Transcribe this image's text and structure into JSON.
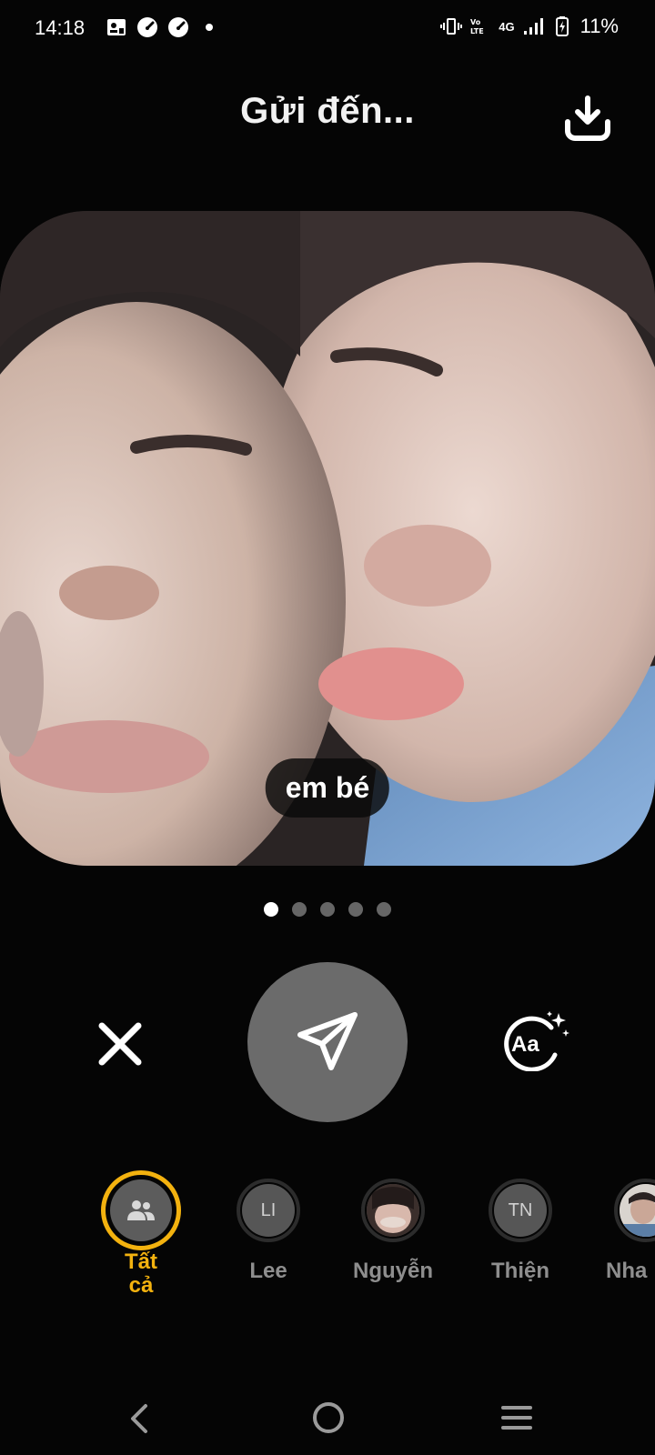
{
  "status_bar": {
    "time": "14:18",
    "network": "4G",
    "battery": "11%",
    "left_icons": [
      "contact-card-icon",
      "speedometer-icon",
      "speedometer-icon",
      "dot-icon"
    ],
    "right_icons": [
      "vibrate-icon",
      "volte-icon",
      "signal-icon",
      "battery-charging-icon"
    ]
  },
  "header": {
    "title": "Gửi đến...",
    "download_icon": "download-icon"
  },
  "photo": {
    "caption": "em bé"
  },
  "pager": {
    "count": 5,
    "active_index": 0
  },
  "actions": {
    "close_icon": "close-icon",
    "send_icon": "send-icon",
    "text_icon": "text-style-icon",
    "text_icon_label": "Aa"
  },
  "recipients": [
    {
      "name": "Tất cả",
      "initials": "",
      "selected": true,
      "avatar": "group-icon"
    },
    {
      "name": "Lee",
      "initials": "LI",
      "selected": false
    },
    {
      "name": "Nguyễn",
      "initials": "",
      "selected": false,
      "avatar": "photo"
    },
    {
      "name": "Thiện",
      "initials": "TN",
      "selected": false
    },
    {
      "name": "Nha",
      "initials": "",
      "selected": false,
      "avatar": "photo"
    }
  ],
  "colors": {
    "accent": "#f3b20f",
    "background": "#050505",
    "send_button": "#6b6b6b"
  }
}
